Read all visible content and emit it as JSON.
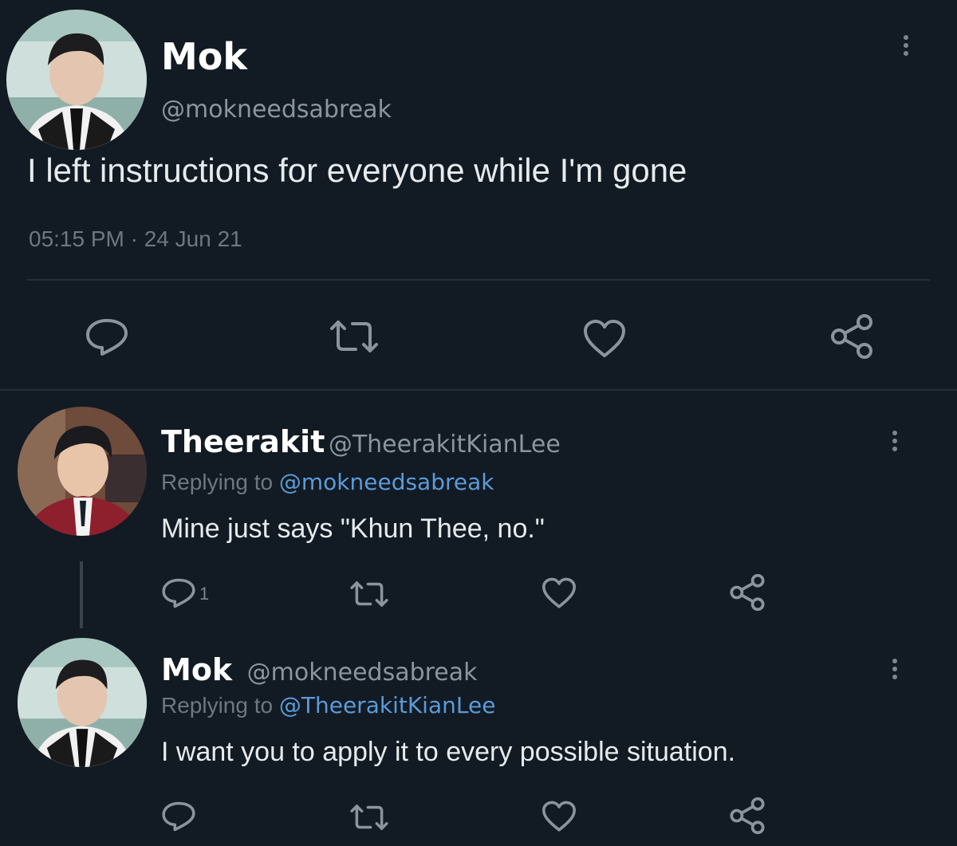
{
  "main_tweet": {
    "name": "Mok",
    "handle": "@mokneedsabreak",
    "text": "I left instructions for everyone while I'm gone",
    "timestamp": "05:15 PM · 24 Jun 21",
    "icons": [
      "reply-icon",
      "retweet-icon",
      "like-icon",
      "share-icon",
      "more-icon"
    ]
  },
  "replies": [
    {
      "name": "Theerakit",
      "handle": "@TheerakitKianLee",
      "replying_prefix": "Replying to ",
      "replying_to": "@mokneedsabreak",
      "text": "Mine just says \"Khun Thee, no.\"",
      "reply_count": "1"
    },
    {
      "name": "Mok",
      "handle": "@mokneedsabreak",
      "replying_prefix": "Replying to ",
      "replying_to": "@TheerakitKianLee",
      "text": "I want you to apply it to every possible situation."
    }
  ],
  "colors": {
    "background": "#121a23",
    "mention": "#5b9bd8",
    "secondary_text": "#6e7781"
  }
}
